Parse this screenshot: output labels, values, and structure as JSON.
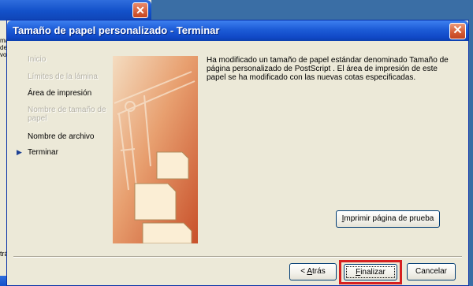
{
  "dialog": {
    "title": "Tamaño de papel personalizado - Terminar",
    "close_glyph": "✕"
  },
  "background_window": {
    "close_glyph": "✕",
    "side_text": "ma de vo",
    "bottom_text": "trá"
  },
  "steps": [
    {
      "label": "Inicio",
      "state": "disabled"
    },
    {
      "label": "Límites de la lámina",
      "state": "disabled"
    },
    {
      "label": "Área de impresión",
      "state": "done"
    },
    {
      "label": "Nombre de tamaño de papel",
      "state": "disabled"
    },
    {
      "label": "Nombre de archivo",
      "state": "done"
    },
    {
      "label": "Terminar",
      "state": "current"
    }
  ],
  "current_step_icon": "arrow-right-icon",
  "message": "Ha modificado un tamaño de papel estándar denominado  Tamaño de página personalizado de PostScript . El área de impresión de este papel se ha modificado con las nuevas cotas especificadas.",
  "buttons": {
    "test_page": {
      "mnemonic": "I",
      "rest": "mprimir página de prueba"
    },
    "back": {
      "prefix": "< ",
      "mnemonic": "A",
      "rest": "trás"
    },
    "finish": {
      "mnemonic": "F",
      "rest": "inalizar"
    },
    "cancel": "Cancelar"
  },
  "colors": {
    "titlebar": "#1c5bd6",
    "highlight": "#d62020",
    "dialog_bg": "#ece9d8"
  }
}
